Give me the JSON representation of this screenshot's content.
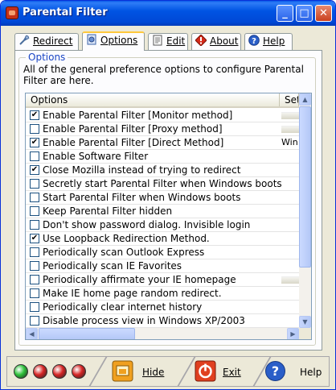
{
  "window": {
    "title": "Parental Filter"
  },
  "title_buttons": {
    "minimize": "_",
    "maximize": "□",
    "close": "✕"
  },
  "tabs": [
    {
      "label": "Redirect",
      "icon": "wrench-icon"
    },
    {
      "label": "Options",
      "icon": "gear-document-icon"
    },
    {
      "label": "Edit",
      "icon": "document-icon"
    },
    {
      "label": "About",
      "icon": "info-diamond-icon"
    },
    {
      "label": "Help",
      "icon": "help-icon"
    }
  ],
  "active_tab": "Options",
  "options_group": {
    "title": "Options",
    "description": "All of the general preference options to configure Parental Filter are here."
  },
  "list": {
    "columns": [
      "Options",
      "Set"
    ],
    "rows": [
      {
        "label": "Enable Parental Filter [Monitor method]",
        "checked": true,
        "setting": ""
      },
      {
        "label": "Enable Parental Filter [Proxy method]",
        "checked": false,
        "setting": ""
      },
      {
        "label": "Enable Parental Filter [Direct Method]",
        "checked": true,
        "setting": "Win"
      },
      {
        "label": "Enable Software Filter",
        "checked": false,
        "setting": ""
      },
      {
        "label": "Close Mozilla instead of trying to redirect",
        "checked": true,
        "setting": ""
      },
      {
        "label": "Secretly start Parental Filter when Windows boots",
        "checked": false,
        "setting": ""
      },
      {
        "label": "Start Parental Filter when Windows boots",
        "checked": false,
        "setting": ""
      },
      {
        "label": "Keep Parental Filter hidden",
        "checked": false,
        "setting": ""
      },
      {
        "label": "Don't show password dialog. Invisible login",
        "checked": false,
        "setting": ""
      },
      {
        "label": "Use Loopback Redirection Method.",
        "checked": true,
        "setting": ""
      },
      {
        "label": "Periodically scan Outlook Express",
        "checked": false,
        "setting": ""
      },
      {
        "label": "Periodically scan IE Favorites",
        "checked": false,
        "setting": ""
      },
      {
        "label": "Periodically affirmate your IE homepage",
        "checked": false,
        "setting": ""
      },
      {
        "label": "Make IE home page random redirect.",
        "checked": false,
        "setting": ""
      },
      {
        "label": "Periodically clear internet history",
        "checked": false,
        "setting": ""
      },
      {
        "label": "Disable process view in Windows XP/2003",
        "checked": false,
        "setting": ""
      }
    ]
  },
  "status_lights": [
    {
      "name": "light-1",
      "color": "#2ec23a"
    },
    {
      "name": "light-2",
      "color": "#d62424"
    },
    {
      "name": "light-3",
      "color": "#d62424"
    },
    {
      "name": "light-4",
      "color": "#d62424"
    }
  ],
  "bottom_buttons": {
    "hide": "Hide",
    "exit": "Exit",
    "help": "Help"
  },
  "colors": {
    "title_bar": "#0054e3",
    "group_title": "#1a46c4",
    "tab_highlight": "#ffc83c"
  }
}
